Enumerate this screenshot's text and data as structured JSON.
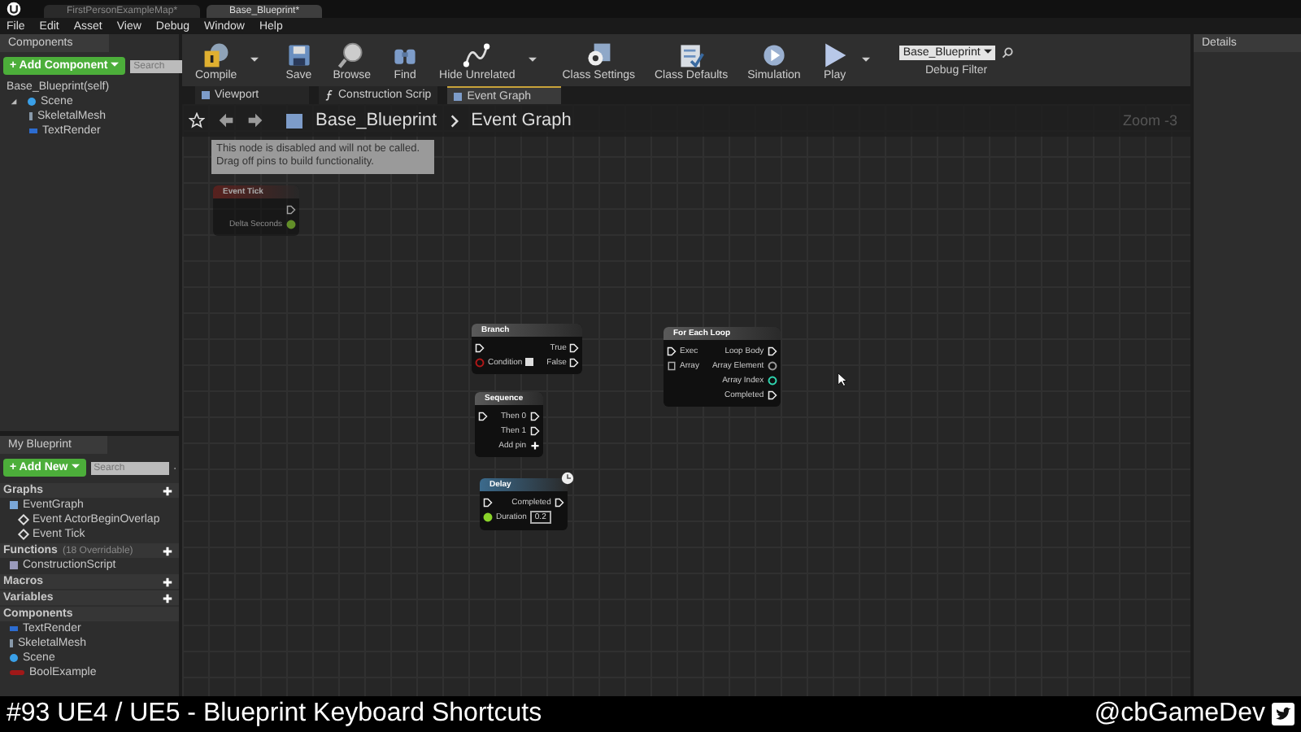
{
  "window_tabs": [
    {
      "label": "FirstPersonExampleMap*",
      "selected": false
    },
    {
      "label": "Base_Blueprint*",
      "selected": true
    }
  ],
  "menu": [
    "File",
    "Edit",
    "Asset",
    "View",
    "Debug",
    "Window",
    "Help"
  ],
  "components_panel": {
    "title": "Components",
    "add_button": "+ Add Component",
    "search_placeholder": "Search",
    "root": "Base_Blueprint(self)",
    "tree": [
      {
        "label": "Scene",
        "kind": "scene",
        "expanded": true,
        "children": [
          {
            "label": "SkeletalMesh",
            "kind": "mesh"
          },
          {
            "label": "TextRender",
            "kind": "text"
          }
        ]
      }
    ]
  },
  "toolbar": [
    {
      "label": "Compile",
      "kind": "compile",
      "dropdown": true
    },
    {
      "label": "Save",
      "kind": "save",
      "dropdown": false
    },
    {
      "label": "Browse",
      "kind": "browse",
      "dropdown": false
    },
    {
      "label": "Find",
      "kind": "find",
      "dropdown": false
    },
    {
      "label": "Hide Unrelated",
      "kind": "hide",
      "dropdown": true
    },
    {
      "label": "Class Settings",
      "kind": "settings",
      "dropdown": false
    },
    {
      "label": "Class Defaults",
      "kind": "defaults",
      "dropdown": false
    },
    {
      "label": "Simulation",
      "kind": "simulation",
      "dropdown": false
    },
    {
      "label": "Play",
      "kind": "play",
      "dropdown": true
    }
  ],
  "debug_filter": {
    "value": "Base_Blueprint",
    "label": "Debug Filter"
  },
  "editor_tabs": [
    {
      "label": "Viewport",
      "kind": "viewport",
      "selected": false
    },
    {
      "label": "Construction Scrip",
      "kind": "function",
      "selected": false
    },
    {
      "label": "Event Graph",
      "kind": "graph",
      "selected": true
    }
  ],
  "breadcrumb": [
    "Base_Blueprint",
    "Event Graph"
  ],
  "zoom": "Zoom -3",
  "tooltip": [
    "This node is disabled and will not be called.",
    "Drag off pins to build functionality."
  ],
  "nodes": [
    {
      "title": "Event Tick",
      "kind": "event",
      "disabled": true,
      "latent": false,
      "rows": [
        {
          "out": {
            "kind": "exec"
          }
        },
        {
          "out": {
            "label": "Delta Seconds",
            "kind": "float"
          }
        }
      ]
    },
    {
      "title": "Branch",
      "kind": "macro",
      "disabled": false,
      "latent": false,
      "rows": [
        {
          "in": {
            "kind": "exec"
          },
          "out": {
            "label": "True",
            "kind": "exec"
          }
        },
        {
          "in": {
            "label": "Condition",
            "kind": "bool",
            "checkbox": true
          },
          "out": {
            "label": "False",
            "kind": "exec"
          }
        }
      ]
    },
    {
      "title": "For Each Loop",
      "kind": "macro",
      "disabled": false,
      "latent": false,
      "rows": [
        {
          "in": {
            "label": "Exec",
            "kind": "exec"
          },
          "out": {
            "label": "Loop Body",
            "kind": "exec"
          }
        },
        {
          "in": {
            "label": "Array",
            "kind": "array"
          },
          "out": {
            "label": "Array Element",
            "kind": "wildcard"
          }
        },
        {
          "out": {
            "label": "Array Index",
            "kind": "int"
          }
        },
        {
          "out": {
            "label": "Completed",
            "kind": "exec"
          }
        }
      ]
    },
    {
      "title": "Sequence",
      "kind": "macro",
      "disabled": false,
      "latent": false,
      "rows": [
        {
          "in": {
            "kind": "exec"
          },
          "out": {
            "label": "Then 0",
            "kind": "exec"
          }
        },
        {
          "out": {
            "label": "Then 1",
            "kind": "exec"
          }
        },
        {
          "out": {
            "label": "Add pin",
            "kind": "add"
          }
        }
      ]
    },
    {
      "title": "Delay",
      "kind": "function",
      "disabled": false,
      "latent": true,
      "rows": [
        {
          "in": {
            "kind": "exec"
          },
          "out": {
            "label": "Completed",
            "kind": "exec"
          }
        },
        {
          "in": {
            "label": "Duration",
            "kind": "float",
            "value": "0.2"
          }
        }
      ]
    }
  ],
  "details": {
    "title": "Details"
  },
  "my_blueprint": {
    "title": "My Blueprint",
    "add_button": "+ Add New",
    "search_placeholder": "Search",
    "sections": [
      {
        "label": "Graphs",
        "add": true,
        "items": [
          {
            "label": "EventGraph",
            "kind": "graph",
            "children": [
              {
                "label": "Event ActorBeginOverlap",
                "kind": "event"
              },
              {
                "label": "Event Tick",
                "kind": "event"
              }
            ]
          }
        ]
      },
      {
        "label": "Functions",
        "note": "(18 Overridable)",
        "add": true,
        "items": [
          {
            "label": "ConstructionScript",
            "kind": "function"
          }
        ]
      },
      {
        "label": "Macros",
        "add": true
      },
      {
        "label": "Variables",
        "add": true
      },
      {
        "label": "Components",
        "add": false,
        "items": [
          {
            "label": "TextRender",
            "kind": "text"
          },
          {
            "label": "SkeletalMesh",
            "kind": "mesh"
          },
          {
            "label": "Scene",
            "kind": "scene"
          },
          {
            "label": "BoolExample",
            "kind": "bool"
          }
        ]
      }
    ]
  },
  "banner": {
    "title": "#93 UE4 / UE5 - Blueprint Keyboard Shortcuts",
    "handle": "@cbGameDev"
  }
}
